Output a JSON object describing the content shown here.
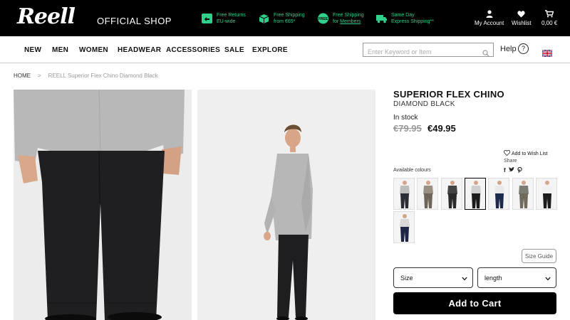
{
  "header": {
    "logo_text": "Reell",
    "shop_label": "OFFICIAL SHOP",
    "usps": [
      {
        "icon": "returns-icon",
        "line1": "Free Returns",
        "line2": "EU-wide"
      },
      {
        "icon": "shipping-box-icon",
        "line1": "Free Shipping",
        "line2": "from €65*"
      },
      {
        "icon": "free-badge-icon",
        "line1": "Free Shipping",
        "line2_prefix": "for ",
        "line2_link": "Members"
      },
      {
        "icon": "truck-icon",
        "line1": "Same Day",
        "line2": "Express Shipping**"
      }
    ],
    "account_label": "My Account",
    "wishlist_label": "Wishlist",
    "cart_label": "0,00 €"
  },
  "nav": {
    "items": [
      "NEW",
      "MEN",
      "WOMEN",
      "HEADWEAR",
      "ACCESSORIES",
      "SALE",
      "EXPLORE"
    ],
    "search_placeholder": "Enter Keyword or Item",
    "help_label": "Help",
    "help_icon_glyph": "?",
    "flag": "uk-flag-icon"
  },
  "breadcrumb": {
    "home": "HOME",
    "separator": ">",
    "current": "REELL Superior Flex Chino Diamond Black"
  },
  "product": {
    "title": "SUPERIOR FLEX CHINO",
    "color_name": "DIAMOND BLACK",
    "stock": "In stock",
    "old_price": "€79.95",
    "price": "€49.95",
    "wishlist_label": "Add to Wish List",
    "share_label": "Share",
    "social_icons": [
      "facebook-icon",
      "twitter-icon",
      "pinterest-icon"
    ],
    "social_glyphs": [
      "f",
      "t",
      "p"
    ],
    "available_colours_label": "Available colours",
    "swatch_count": 8,
    "selected_swatch": 4,
    "size_guide_label": "Size Guide",
    "size_placeholder": "Size",
    "length_placeholder": "length",
    "add_to_cart_label": "Add to Cart"
  },
  "colors": {
    "topbar_bg": "#000000",
    "usp_green": "#2fd08a",
    "accent_black": "#000000"
  }
}
